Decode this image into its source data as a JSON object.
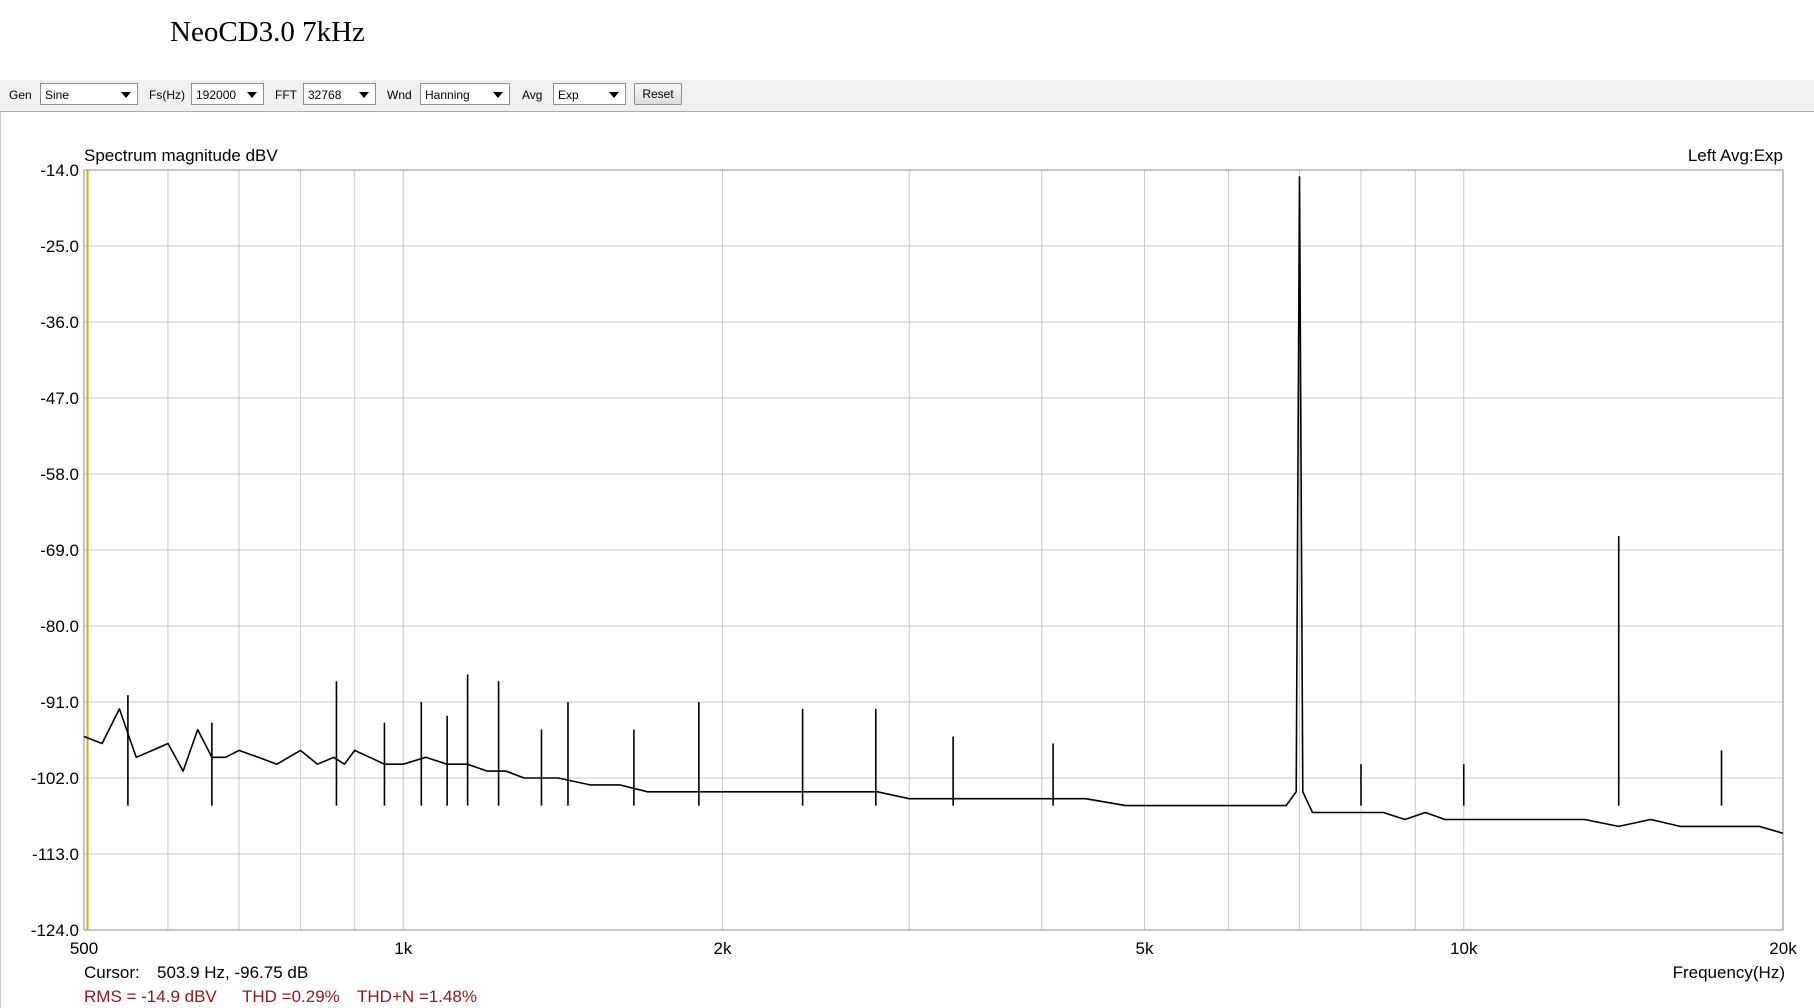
{
  "caption": "NeoCD3.0 7kHz",
  "toolbar": {
    "gen_label": "Gen",
    "gen_value": "Sine",
    "fs_label": "Fs(Hz)",
    "fs_value": "192000",
    "fft_label": "FFT",
    "fft_value": "32768",
    "wnd_label": "Wnd",
    "wnd_value": "Hanning",
    "avg_label": "Avg",
    "avg_value": "Exp",
    "reset_label": "Reset"
  },
  "status": {
    "cursor_label": "Cursor:",
    "cursor_value": "503.9 Hz, -96.75 dB",
    "rms": "RMS =  -14.9 dBV",
    "thd": "THD =0.29%",
    "thdn": "THD+N =1.48%",
    "stat_color": "#8b1a1a"
  },
  "chart_data": {
    "type": "line",
    "title": "Spectrum magnitude dBV",
    "channel_info": "Left  Avg:Exp",
    "xlabel": "Frequency(Hz)",
    "ylabel": "",
    "x_scale": "log",
    "xlim": [
      500,
      20000
    ],
    "ylim": [
      -124,
      -14
    ],
    "grid": true,
    "x_tick_values": [
      500,
      1000,
      2000,
      5000,
      10000,
      20000
    ],
    "x_tick_labels": [
      "500",
      "1k",
      "2k",
      "5k",
      "10k",
      "20k"
    ],
    "x_minor_gridlines": [
      600,
      700,
      800,
      900,
      3000,
      4000,
      6000,
      7000,
      8000,
      9000
    ],
    "y_tick_values": [
      -14,
      -25,
      -36,
      -47,
      -58,
      -69,
      -80,
      -91,
      -102,
      -113,
      -124
    ],
    "y_tick_labels": [
      "-14.0",
      "-25.0",
      "-36.0",
      "-47.0",
      "-58.0",
      "-69.0",
      "-80.0",
      "-91.0",
      "-102.0",
      "-113.0",
      "-124.0"
    ],
    "cursor_x": 503.9,
    "cursor_color": "#c8b400",
    "line_color": "#000000",
    "series": [
      {
        "x": [
          500,
          520,
          540,
          560,
          580,
          600,
          620,
          640,
          660,
          680,
          700,
          730,
          760,
          800,
          830,
          860,
          880,
          900,
          930,
          960,
          1000,
          1050,
          1100,
          1150,
          1200,
          1250,
          1300,
          1400,
          1500,
          1600,
          1700,
          1800,
          1900,
          2000,
          2200,
          2400,
          2600,
          2800,
          3000,
          3300,
          3600,
          4000,
          4400,
          4800,
          5200,
          5600,
          6000,
          6400,
          6800,
          6950,
          7000,
          7050,
          7200,
          7600,
          8000,
          8400,
          8800,
          9200,
          9600,
          10000,
          11000,
          12000,
          13000,
          14000,
          15000,
          16000,
          17000,
          18000,
          19000,
          20000
        ],
        "y": [
          -96,
          -97,
          -92,
          -99,
          -98,
          -97,
          -101,
          -95,
          -99,
          -99,
          -98,
          -99,
          -100,
          -98,
          -100,
          -99,
          -100,
          -98,
          -99,
          -100,
          -100,
          -99,
          -100,
          -100,
          -101,
          -101,
          -102,
          -102,
          -103,
          -103,
          -104,
          -104,
          -104,
          -104,
          -104,
          -104,
          -104,
          -104,
          -105,
          -105,
          -105,
          -105,
          -105,
          -106,
          -106,
          -106,
          -106,
          -106,
          -106,
          -104,
          -15,
          -104,
          -107,
          -107,
          -107,
          -107,
          -108,
          -107,
          -108,
          -108,
          -108,
          -108,
          -108,
          -109,
          -108,
          -109,
          -109,
          -109,
          -109,
          -110
        ]
      }
    ],
    "spurs": [
      {
        "x": 550,
        "y": -90
      },
      {
        "x": 660,
        "y": -94
      },
      {
        "x": 865,
        "y": -88
      },
      {
        "x": 960,
        "y": -94
      },
      {
        "x": 1040,
        "y": -91
      },
      {
        "x": 1100,
        "y": -93
      },
      {
        "x": 1150,
        "y": -87
      },
      {
        "x": 1230,
        "y": -88
      },
      {
        "x": 1350,
        "y": -95
      },
      {
        "x": 1430,
        "y": -91
      },
      {
        "x": 1650,
        "y": -95
      },
      {
        "x": 1900,
        "y": -91
      },
      {
        "x": 2380,
        "y": -92
      },
      {
        "x": 2790,
        "y": -92
      },
      {
        "x": 3300,
        "y": -96
      },
      {
        "x": 4100,
        "y": -97
      },
      {
        "x": 8000,
        "y": -100
      },
      {
        "x": 10000,
        "y": -100
      },
      {
        "x": 14000,
        "y": -67
      },
      {
        "x": 17500,
        "y": -98
      }
    ]
  }
}
